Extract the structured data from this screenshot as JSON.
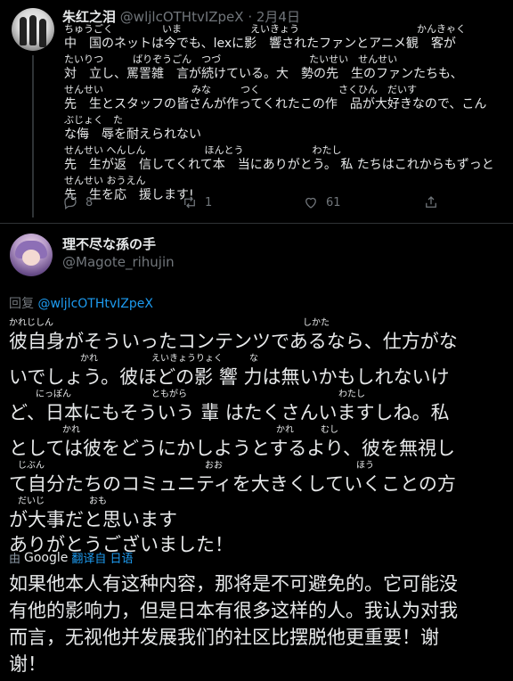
{
  "tweet1": {
    "author_name": "朱红之泪",
    "author_handle": "@wljlcOTHtvIZpeX",
    "separator": "·",
    "date": "2月4日",
    "body_lines": [
      {
        "ruby": "ちゅうごく　　　　　いま　　　　　　　えいきょう　　　　　　　　　　　　かんきゃく",
        "text": "中　国のネットは今でも、lexに影　響されたファンとアニメ観　客が"
      },
      {
        "ruby": "たいりつ　　　ばりぞうごん　つづ　　　　　　　　　たいせい　せんせい",
        "text": "対　立し、罵詈雑　言が続けている。大　勢の先　生のファンたちも、"
      },
      {
        "ruby": "せんせい　　　　　　　　　みな　　　つく　　　　　　　　さくひん　だいす",
        "text": "先　生とスタッフの皆さんが作ってくれたこの作　品が大好きなので、こん"
      },
      {
        "ruby": "ぶじょく　た",
        "text": "な侮　辱を耐えられない"
      },
      {
        "ruby": "せんせい へんしん　　　　　　ほんとう　　　　　　　わたし",
        "text": "先　生が返　信してくれて本　当にありがとう。 私 たちはこれからもずっと"
      },
      {
        "ruby": "せんせい おうえん",
        "text": "先　生を応　援します!"
      }
    ],
    "actions": {
      "reply_count": "8",
      "retweet_count": "1",
      "like_count": "61"
    }
  },
  "tweet2": {
    "author_name": "理不尽な孫の手",
    "author_handle": "@Magote_rihujin",
    "reply_label": "回复",
    "reply_to": "@wljlcOTHtvIZpeX",
    "body_lines": [
      {
        "ruby": "かれじしん　　　　　　　　　　　　　　　　　　　　　　　　　　　　しかた",
        "text": "彼自身がそういったコンテンツであるなら、仕方がな"
      },
      {
        "ruby": "　　　　　　　　かれ　　　　　　えいきょうりょく　　　な",
        "text": "いでしょう。彼ほどの影 響 力は無いかもしれないけ"
      },
      {
        "ruby": "　　　にっぽん　　　　　　　　　ともがら　　　　　　　　　　　　　　　　　わたし",
        "text": "ど、日本にもそういう 輩 はたくさんいますしね。私"
      },
      {
        "ruby": "　　　　　　かれ　　　　　　　　　　　　　　　　　　　　　　かれ　　　むし",
        "text": "としては彼をどうにかしようとするより、彼を無視し"
      },
      {
        "ruby": "　じぶん　　　　　　　　　　　　　　　　　　おお　　　　　　　　　　　　　　　ほう",
        "text": "て自分たちのコミュニティを大きくしていくことの方"
      },
      {
        "ruby": "　だいじ　　　　　おも",
        "text": "が大事だと思います"
      },
      {
        "ruby": "",
        "text": "ありがとうございました！"
      }
    ],
    "translation": {
      "prefix": "由",
      "brand": "Google",
      "link": "翻译自 日语"
    },
    "translated_lines": [
      "如果他本人有这种内容，那将是不可避免的。它可能没",
      "有他的影响力，但是日本有很多这样的人。我认为对我",
      "而言，无视他并发展我们的社区比摆脱他更重要！谢",
      "谢！"
    ]
  },
  "icons": {
    "reply": "reply-icon",
    "retweet": "retweet-icon",
    "like": "heart-icon",
    "share": "share-icon"
  },
  "colors": {
    "background": "#000000",
    "text": "#e7e9ea",
    "muted": "#71767b",
    "link": "#1d9bf0",
    "divider": "#2f3336"
  }
}
